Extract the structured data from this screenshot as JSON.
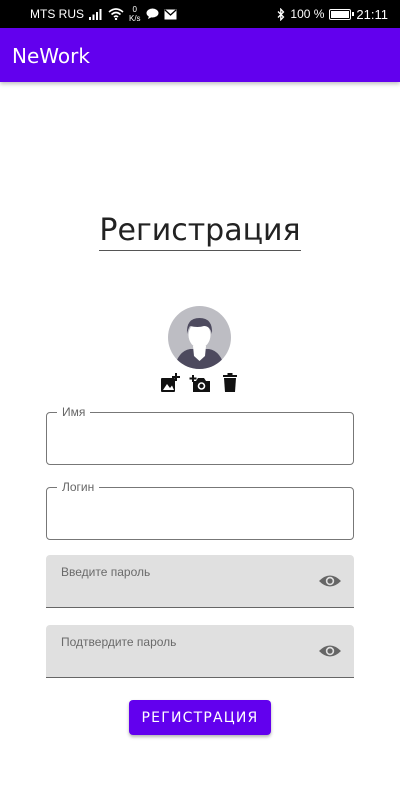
{
  "status_bar": {
    "carrier": "MTS RUS",
    "speed_value": "0",
    "speed_unit": "K/s",
    "battery_percent": "100 %",
    "battery_level": 1.0,
    "time": "21:11"
  },
  "app_bar": {
    "title": "NeWork",
    "color": "#6200ee"
  },
  "page": {
    "heading": "Регистрация"
  },
  "avatar": {
    "icons": [
      "add-image-icon",
      "camera-add-icon",
      "delete-icon"
    ]
  },
  "form": {
    "name_label": "Имя",
    "name_value": "",
    "login_label": "Логин",
    "login_value": "",
    "password_label": "Введите пароль",
    "password_value": "",
    "confirm_label": "Подтвердите пароль",
    "confirm_value": ""
  },
  "button": {
    "label": "РЕГИСТРАЦИЯ"
  }
}
